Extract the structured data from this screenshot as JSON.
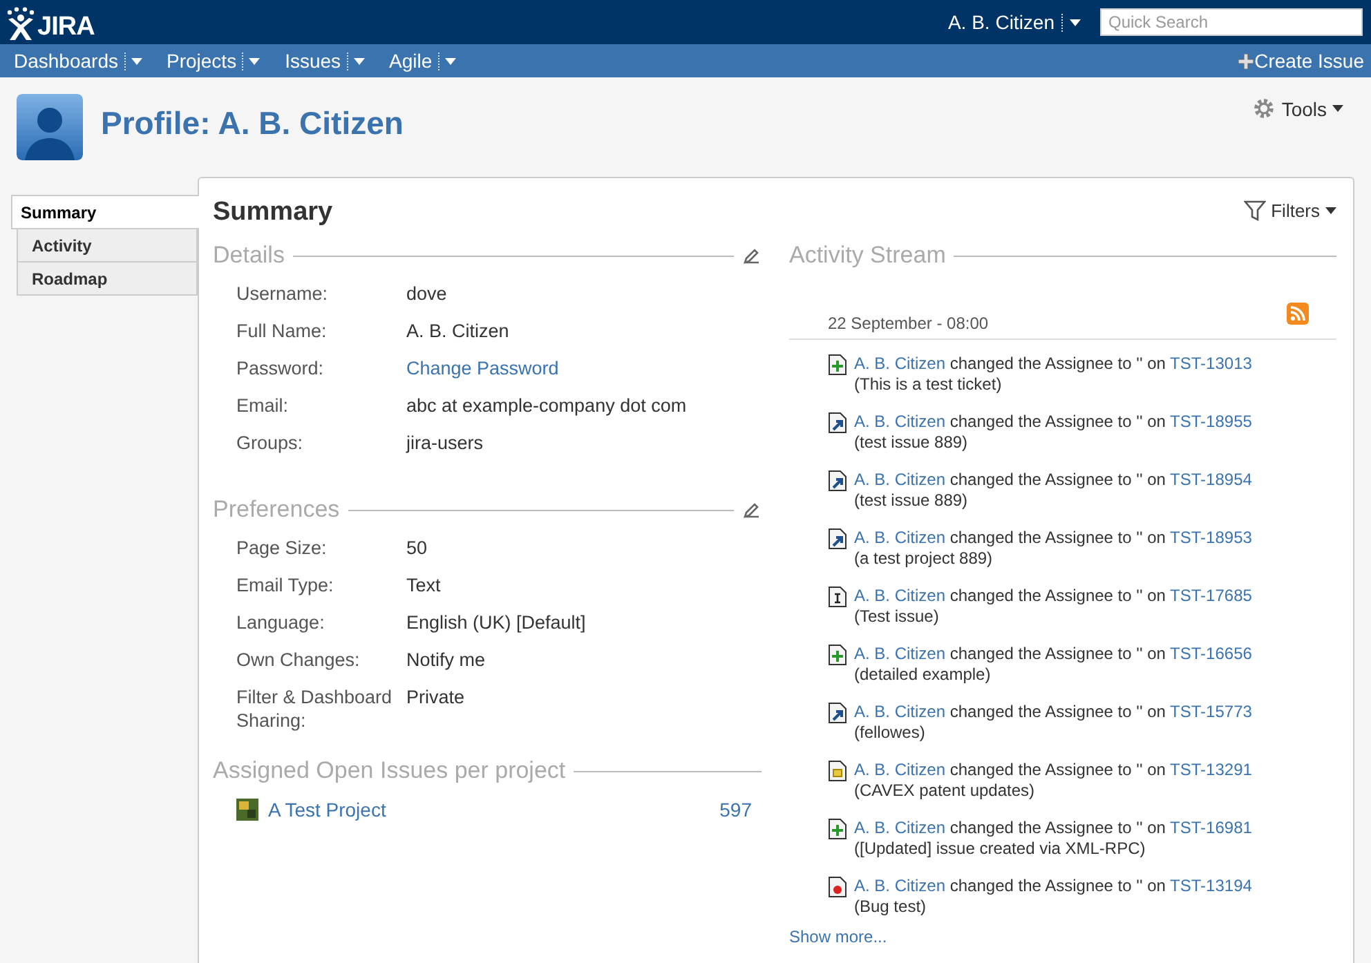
{
  "header": {
    "logo": "JIRA",
    "user": "A. B. Citizen",
    "search": {
      "placeholder": "Quick Search"
    }
  },
  "nav": {
    "items": [
      "Dashboards",
      "Projects",
      "Issues",
      "Agile"
    ],
    "create": "Create Issue"
  },
  "page": {
    "title": "Profile: A. B. Citizen",
    "tools": "Tools"
  },
  "tabs": [
    {
      "label": "Summary",
      "selected": true
    },
    {
      "label": "Activity",
      "selected": false
    },
    {
      "label": "Roadmap",
      "selected": false
    }
  ],
  "summary": {
    "title": "Summary",
    "filters": "Filters",
    "details": {
      "title": "Details",
      "rows": [
        {
          "label": "Username:",
          "value": "dove",
          "kind": "text"
        },
        {
          "label": "Full Name:",
          "value": "A. B. Citizen",
          "kind": "text"
        },
        {
          "label": "Password:",
          "value": "Change Password",
          "kind": "link"
        },
        {
          "label": "Email:",
          "value": "abc at example-company dot com",
          "kind": "text"
        },
        {
          "label": "Groups:",
          "value": "jira-users",
          "kind": "text"
        }
      ]
    },
    "preferences": {
      "title": "Preferences",
      "rows": [
        {
          "label": "Page Size:",
          "value": "50",
          "kind": "text"
        },
        {
          "label": "Email Type:",
          "value": "Text",
          "kind": "text"
        },
        {
          "label": "Language:",
          "value": "English (UK) [Default]",
          "kind": "text"
        },
        {
          "label": "Own Changes:",
          "value": "Notify me",
          "kind": "text"
        },
        {
          "label": "Filter & Dashboard Sharing:",
          "value": "Private",
          "kind": "text"
        }
      ]
    },
    "assigned": {
      "title": "Assigned Open Issues per project",
      "projects": [
        {
          "name": "A Test Project",
          "count": "597"
        }
      ]
    },
    "activity": {
      "title": "Activity Stream",
      "date": "22 September - 08:00",
      "more": "Show more...",
      "items": [
        {
          "kind": "new",
          "user": "A. B. Citizen",
          "action": "changed the Assignee to '' on",
          "issue": "TST-13013",
          "summary": "(This is a test ticket)"
        },
        {
          "kind": "improvement",
          "user": "A. B. Citizen",
          "action": "changed the Assignee to '' on",
          "issue": "TST-18955",
          "summary": "(test issue 889)"
        },
        {
          "kind": "improvement",
          "user": "A. B. Citizen",
          "action": "changed the Assignee to '' on",
          "issue": "TST-18954",
          "summary": "(test issue 889)"
        },
        {
          "kind": "improvement",
          "user": "A. B. Citizen",
          "action": "changed the Assignee to '' on",
          "issue": "TST-18953",
          "summary": "(a test project 889)"
        },
        {
          "kind": "task",
          "user": "A. B. Citizen",
          "action": "changed the Assignee to '' on",
          "issue": "TST-17685",
          "summary": "(Test issue)"
        },
        {
          "kind": "new",
          "user": "A. B. Citizen",
          "action": "changed the Assignee to '' on",
          "issue": "TST-16656",
          "summary": "(detailed example)"
        },
        {
          "kind": "improvement",
          "user": "A. B. Citizen",
          "action": "changed the Assignee to '' on",
          "issue": "TST-15773",
          "summary": "(fellowes)"
        },
        {
          "kind": "subtask",
          "user": "A. B. Citizen",
          "action": "changed the Assignee to '' on",
          "issue": "TST-13291",
          "summary": "(CAVEX patent updates)"
        },
        {
          "kind": "new",
          "user": "A. B. Citizen",
          "action": "changed the Assignee to '' on",
          "issue": "TST-16981",
          "summary": "([Updated] issue created via XML-RPC)"
        },
        {
          "kind": "bug",
          "user": "A. B. Citizen",
          "action": "changed the Assignee to '' on",
          "issue": "TST-13194",
          "summary": "(Bug test)"
        }
      ]
    }
  }
}
